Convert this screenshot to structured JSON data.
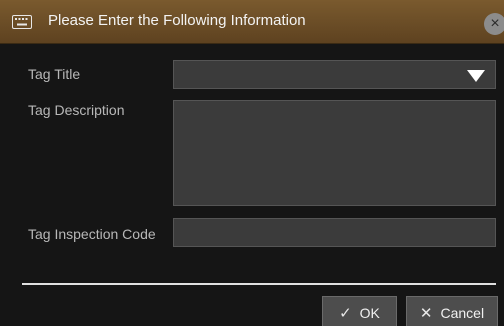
{
  "dialog": {
    "title": "Please Enter the Following Information",
    "close_symbol": "×",
    "title_icon": "keyboard-icon"
  },
  "form": {
    "tag_title_label": "Tag Title",
    "tag_title_value": "",
    "tag_description_label": "Tag Description",
    "tag_description_value": "",
    "tag_inspection_code_label": "Tag Inspection Code",
    "tag_inspection_code_value": ""
  },
  "buttons": {
    "ok_label": "OK",
    "ok_icon": "✓",
    "cancel_label": "Cancel",
    "cancel_icon": "✕"
  },
  "colors": {
    "titlebar": "#6b4d26",
    "background": "#151515",
    "field": "#3b3b3b",
    "button": "#4d4d4d"
  }
}
